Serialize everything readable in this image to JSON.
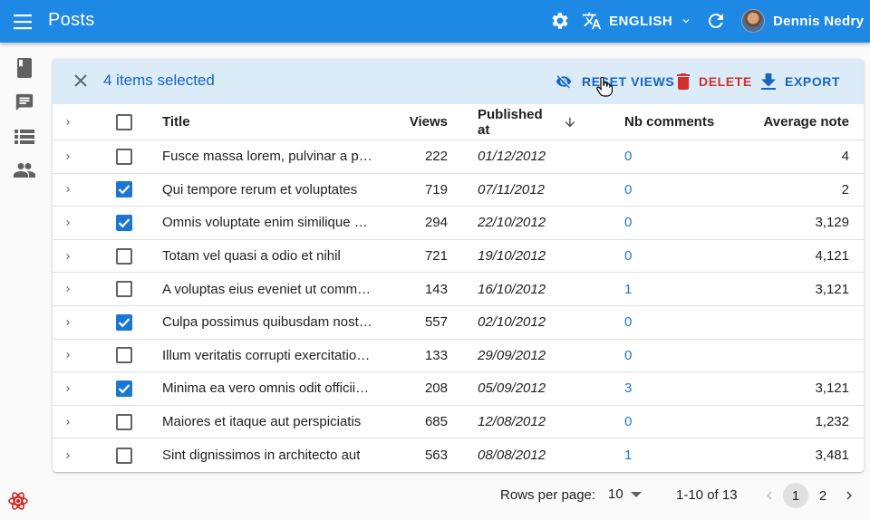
{
  "app": {
    "title": "Posts",
    "language": "ENGLISH",
    "user_name": "Dennis Nedry"
  },
  "sidebar": {
    "items": [
      {
        "name": "posts",
        "icon": "book-icon"
      },
      {
        "name": "comments",
        "icon": "chat-icon"
      },
      {
        "name": "tags",
        "icon": "list-icon"
      },
      {
        "name": "users",
        "icon": "people-icon"
      }
    ]
  },
  "bulk_actions": {
    "selected_text": "4 items selected",
    "reset_views": "RESET VIEWS",
    "delete": "DELETE",
    "export": "EXPORT"
  },
  "table": {
    "headers": {
      "title": "Title",
      "views": "Views",
      "published_at": "Published at",
      "nb_comments": "Nb comments",
      "average_note": "Average note"
    },
    "rows": [
      {
        "title": "Fusce massa lorem, pulvinar a p…",
        "views": "222",
        "date": "01/12/2012",
        "comments": "0",
        "note": "4",
        "checked": false
      },
      {
        "title": "Qui tempore rerum et voluptates",
        "views": "719",
        "date": "07/11/2012",
        "comments": "0",
        "note": "2",
        "checked": true
      },
      {
        "title": "Omnis voluptate enim similique e…",
        "views": "294",
        "date": "22/10/2012",
        "comments": "0",
        "note": "3,129",
        "checked": true
      },
      {
        "title": "Totam vel quasi a odio et nihil",
        "views": "721",
        "date": "19/10/2012",
        "comments": "0",
        "note": "4,121",
        "checked": false
      },
      {
        "title": "A voluptas eius eveniet ut comm…",
        "views": "143",
        "date": "16/10/2012",
        "comments": "1",
        "note": "3,121",
        "checked": false
      },
      {
        "title": "Culpa possimus quibusdam nost…",
        "views": "557",
        "date": "02/10/2012",
        "comments": "0",
        "note": "",
        "checked": true
      },
      {
        "title": "Illum veritatis corrupti exercitatio…",
        "views": "133",
        "date": "29/09/2012",
        "comments": "0",
        "note": "",
        "checked": false
      },
      {
        "title": "Minima ea vero omnis odit officii…",
        "views": "208",
        "date": "05/09/2012",
        "comments": "3",
        "note": "3,121",
        "checked": true
      },
      {
        "title": "Maiores et itaque aut perspiciatis",
        "views": "685",
        "date": "12/08/2012",
        "comments": "0",
        "note": "1,232",
        "checked": false
      },
      {
        "title": "Sint dignissimos in architecto aut",
        "views": "563",
        "date": "08/08/2012",
        "comments": "1",
        "note": "3,481",
        "checked": false
      }
    ]
  },
  "pagination": {
    "rows_per_page_label": "Rows per page:",
    "rows_per_page_value": "10",
    "range": "1-10 of 13",
    "page1": "1",
    "page2": "2"
  },
  "colors": {
    "appbar": "#1e88e5",
    "accent": "#1976d2",
    "danger": "#d32f2f",
    "bulkbar": "#dcebf8"
  }
}
